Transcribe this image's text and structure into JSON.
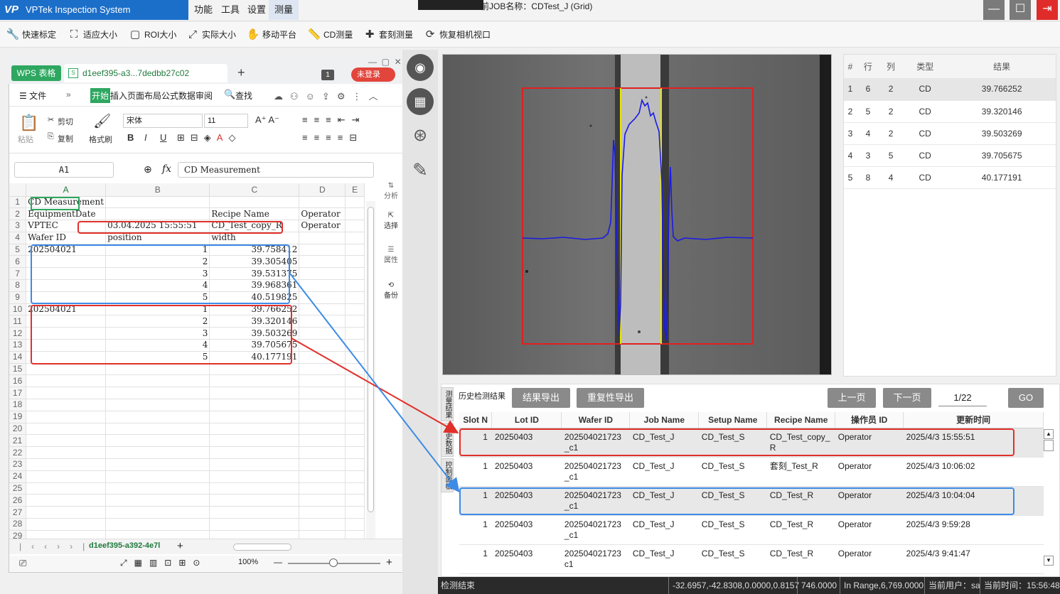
{
  "app": {
    "title": "VPTek Inspection System 1.0.0.0[Admin]",
    "logo": "VP",
    "menus": [
      "功能",
      "工具",
      "设置",
      "测量"
    ],
    "job_info": "前JOB名称：CDTest_J (Grid)",
    "window_buttons": [
      "—",
      "☐",
      "⇥"
    ]
  },
  "toolbar": [
    {
      "icon": "wrench-icon",
      "glyph": "🔧",
      "label": "快速标定"
    },
    {
      "icon": "fit-icon",
      "glyph": "⛶",
      "label": "适应大小"
    },
    {
      "icon": "roi-icon",
      "glyph": "▢",
      "label": "ROI大小"
    },
    {
      "icon": "actual-size-icon",
      "glyph": "⤢",
      "label": "实际大小"
    },
    {
      "icon": "hand-icon",
      "glyph": "✋",
      "label": "移动平台"
    },
    {
      "icon": "ruler-icon",
      "glyph": "📏",
      "label": "CD测量"
    },
    {
      "icon": "plus-icon",
      "glyph": "✚",
      "label": "套刻测量"
    },
    {
      "icon": "refresh-camera-icon",
      "glyph": "⟳",
      "label": "恢复相机视口"
    }
  ],
  "wps": {
    "badge": "WPS 表格",
    "file_tab": "d1eef395-a3...7dedbb27c02",
    "count_badge": "1",
    "login": "未登录",
    "menu": {
      "file": "☰ 文件",
      "start": "开始",
      "tabs": "插入页面布局公式数据审阅",
      "find": "查找"
    },
    "ribbon": {
      "paste": "粘贴",
      "cut": "剪切",
      "copy": "复制",
      "format_painter": "格式刷",
      "font": "宋体",
      "size": "11",
      "bold": "B",
      "italic": "I",
      "underline": "U"
    },
    "namebox": "A1",
    "fx": "fx",
    "formula": "CD Measurement",
    "columns": [
      "A",
      "B",
      "C",
      "D",
      "E"
    ],
    "rows": [
      [
        "CD Measurement",
        "",
        "",
        "",
        ""
      ],
      [
        "EquipmentDate",
        "",
        "Recipe Name",
        "Operator",
        ""
      ],
      [
        "VPTEC",
        "03.04.2025 15:55:51",
        "CD_Test_copy_R",
        "Operator",
        ""
      ],
      [
        "Wafer ID",
        "position",
        "width",
        "",
        ""
      ],
      [
        "202504021",
        "1",
        "39.758412",
        "",
        ""
      ],
      [
        "",
        "2",
        "39.305405",
        "",
        ""
      ],
      [
        "",
        "3",
        "39.531375",
        "",
        ""
      ],
      [
        "",
        "4",
        "39.968361",
        "",
        ""
      ],
      [
        "",
        "5",
        "40.519825",
        "",
        ""
      ],
      [
        "202504021",
        "1",
        "39.766252",
        "",
        ""
      ],
      [
        "",
        "2",
        "39.320146",
        "",
        ""
      ],
      [
        "",
        "3",
        "39.503269",
        "",
        ""
      ],
      [
        "",
        "4",
        "39.705675",
        "",
        ""
      ],
      [
        "",
        "5",
        "40.177191",
        "",
        ""
      ],
      [
        "",
        "",
        "",
        "",
        ""
      ],
      [
        "",
        "",
        "",
        "",
        ""
      ],
      [
        "",
        "",
        "",
        "",
        ""
      ],
      [
        "",
        "",
        "",
        "",
        ""
      ],
      [
        "",
        "",
        "",
        "",
        ""
      ],
      [
        "",
        "",
        "",
        "",
        ""
      ],
      [
        "",
        "",
        "",
        "",
        ""
      ],
      [
        "",
        "",
        "",
        "",
        ""
      ],
      [
        "",
        "",
        "",
        "",
        ""
      ],
      [
        "",
        "",
        "",
        "",
        ""
      ],
      [
        "",
        "",
        "",
        "",
        ""
      ],
      [
        "",
        "",
        "",
        "",
        ""
      ],
      [
        "",
        "",
        "",
        "",
        ""
      ],
      [
        "",
        "",
        "",
        "",
        ""
      ],
      [
        "",
        "",
        "",
        "",
        ""
      ]
    ],
    "sheet_tab": "d1eef395-a392-4e7l",
    "zoom": "100%",
    "side_tools": [
      "分析",
      "选择",
      "属性",
      "备份"
    ]
  },
  "results": {
    "headers": [
      "#",
      "行",
      "列",
      "类型",
      "结果"
    ],
    "rows": [
      [
        "1",
        "6",
        "2",
        "CD",
        "39.766252"
      ],
      [
        "2",
        "5",
        "2",
        "CD",
        "39.320146"
      ],
      [
        "3",
        "4",
        "2",
        "CD",
        "39.503269"
      ],
      [
        "4",
        "3",
        "5",
        "CD",
        "39.705675"
      ],
      [
        "5",
        "8",
        "4",
        "CD",
        "40.177191"
      ]
    ]
  },
  "history": {
    "label": "历史检测结果",
    "side_tabs": [
      "测量结果",
      "历史数据",
      "控制面板"
    ],
    "export_btn": "结果导出",
    "repeat_btn": "重复性导出",
    "prev_btn": "上一页",
    "next_btn": "下一页",
    "page": "1/22",
    "go_btn": "GO",
    "headers": [
      "Slot N",
      "Lot ID",
      "Wafer ID",
      "Job Name",
      "Setup Name",
      "Recipe Name",
      "操作员 ID",
      "更新时间"
    ],
    "rows": [
      [
        "1",
        "20250403",
        "202504021723\n_c1",
        "CD_Test_J",
        "CD_Test_S",
        "CD_Test_copy_\nR",
        "Operator",
        "2025/4/3 15:55:51"
      ],
      [
        "1",
        "20250403",
        "202504021723\n_c1",
        "CD_Test_J",
        "CD_Test_S",
        "套刻_Test_R",
        "Operator",
        "2025/4/3 10:06:02"
      ],
      [
        "1",
        "20250403",
        "202504021723\n_c1",
        "CD_Test_J",
        "CD_Test_S",
        "CD_Test_R",
        "Operator",
        "2025/4/3 10:04:04"
      ],
      [
        "1",
        "20250403",
        "202504021723\n_c1",
        "CD_Test_J",
        "CD_Test_S",
        "CD_Test_R",
        "Operator",
        "2025/4/3 9:59:28"
      ],
      [
        "1",
        "20250403",
        "202504021723\nc1",
        "CD_Test_J",
        "CD_Test_S",
        "CD_Test_R",
        "Operator",
        "2025/4/3 9:41:47"
      ]
    ]
  },
  "status": {
    "left": "检测结束",
    "coords": "-32.6957,-42.8308,0.0000,0.8157",
    "value": "746.0000",
    "range": "In Range,6,769.0000",
    "user": "当前用户：sa",
    "time": "当前时间：15:56:48"
  },
  "colors": {
    "accent": "#1c6fc9",
    "red_highlight": "#e0302a",
    "blue_highlight": "#3d8be6",
    "profile_line": "#1a1ae6",
    "roi_box": "#e02020",
    "edge_lines": "#e6e600"
  }
}
